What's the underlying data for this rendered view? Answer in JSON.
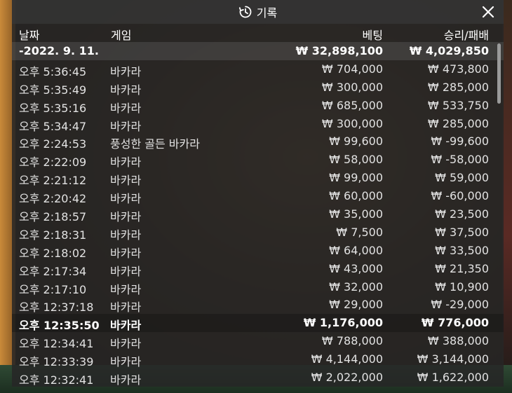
{
  "window": {
    "title": "기록"
  },
  "columns": {
    "date": "날짜",
    "game": "게임",
    "bet": "베팅",
    "win_loss": "승리/패배"
  },
  "date_group": {
    "date": "-2022. 9. 11.",
    "bet_total": "₩ 32,898,100",
    "win_total": "₩ 4,029,850"
  },
  "rows": [
    {
      "time": "오후 5:36:45",
      "game": "바카라",
      "bet": "₩ 704,000",
      "win": "₩ 473,800"
    },
    {
      "time": "오후 5:35:49",
      "game": "바카라",
      "bet": "₩ 300,000",
      "win": "₩ 285,000"
    },
    {
      "time": "오후 5:35:16",
      "game": "바카라",
      "bet": "₩ 685,000",
      "win": "₩ 533,750"
    },
    {
      "time": "오후 5:34:47",
      "game": "바카라",
      "bet": "₩ 300,000",
      "win": "₩ 285,000"
    },
    {
      "time": "오후 2:24:53",
      "game": "풍성한 골든 바카라",
      "bet": "₩ 99,600",
      "win": "₩ -99,600"
    },
    {
      "time": "오후 2:22:09",
      "game": "바카라",
      "bet": "₩ 58,000",
      "win": "₩ -58,000"
    },
    {
      "time": "오후 2:21:12",
      "game": "바카라",
      "bet": "₩ 99,000",
      "win": "₩ 59,000"
    },
    {
      "time": "오후 2:20:42",
      "game": "바카라",
      "bet": "₩ 60,000",
      "win": "₩ -60,000"
    },
    {
      "time": "오후 2:18:57",
      "game": "바카라",
      "bet": "₩ 35,000",
      "win": "₩ 23,500"
    },
    {
      "time": "오후 2:18:31",
      "game": "바카라",
      "bet": "₩ 7,500",
      "win": "₩ 37,500"
    },
    {
      "time": "오후 2:18:02",
      "game": "바카라",
      "bet": "₩ 64,000",
      "win": "₩ 33,500"
    },
    {
      "time": "오후 2:17:34",
      "game": "바카라",
      "bet": "₩ 43,000",
      "win": "₩ 21,350"
    },
    {
      "time": "오후 2:17:10",
      "game": "바카라",
      "bet": "₩ 32,000",
      "win": "₩ 10,900"
    },
    {
      "time": "오후 12:37:18",
      "game": "바카라",
      "bet": "₩ 29,000",
      "win": "₩ -29,000"
    },
    {
      "time": "오후 12:35:50",
      "game": "바카라",
      "bet": "₩ 1,176,000",
      "win": "₩ 776,000"
    },
    {
      "time": "오후 12:34:41",
      "game": "바카라",
      "bet": "₩ 788,000",
      "win": "₩ 388,000"
    },
    {
      "time": "오후 12:33:39",
      "game": "바카라",
      "bet": "₩ 4,144,000",
      "win": "₩ 3,144,000"
    },
    {
      "time": "오후 12:32:41",
      "game": "바카라",
      "bet": "₩ 2,022,000",
      "win": "₩ 1,622,000"
    }
  ],
  "icons": {
    "title": "history-icon",
    "close": "close-icon"
  }
}
